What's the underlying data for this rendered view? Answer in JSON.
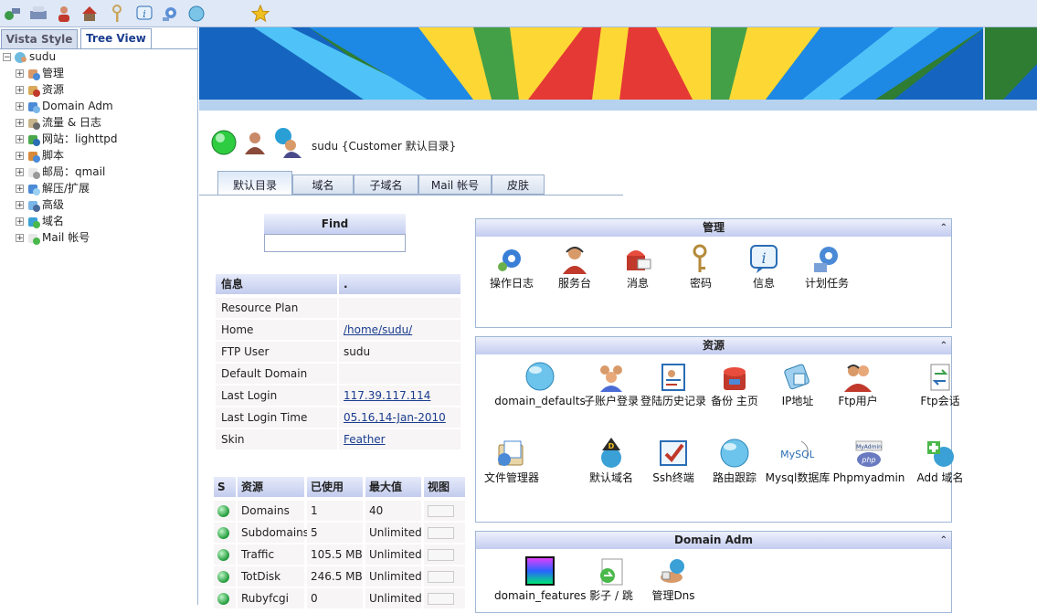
{
  "left_tabs": {
    "vista": "Vista Style",
    "tree": "Tree View"
  },
  "tree": {
    "root": "sudu",
    "items": [
      "管理",
      "资源",
      "Domain Adm",
      "流量 & 日志",
      "网站：lighttpd",
      "脚本",
      "邮局：qmail",
      "解压/扩展",
      "高级",
      "域名",
      "Mail 帐号"
    ]
  },
  "header": {
    "title": "sudu {Customer 默认目录}"
  },
  "tabs": [
    "默认目录",
    "域名",
    "子域名",
    "Mail 帐号",
    "皮肤"
  ],
  "find": {
    "label": "Find",
    "value": ""
  },
  "info": {
    "head_key": "信息",
    "head_val": ".",
    "rows": [
      {
        "k": "Resource Plan",
        "v": ""
      },
      {
        "k": "Home",
        "v": "/home/sudu/"
      },
      {
        "k": "FTP User",
        "v": "sudu"
      },
      {
        "k": "Default Domain",
        "v": ""
      },
      {
        "k": "Last Login",
        "v": "117.39.117.114"
      },
      {
        "k": "Last Login Time",
        "v": "05.16,14-Jan-2010"
      },
      {
        "k": "Skin",
        "v": "Feather"
      }
    ]
  },
  "usage": {
    "headers": [
      "S",
      "资源",
      "已使用",
      "最大值",
      "视图"
    ],
    "rows": [
      {
        "name": "Domains",
        "used": "1",
        "max": "40"
      },
      {
        "name": "Subdomains",
        "used": "5",
        "max": "Unlimited"
      },
      {
        "name": "Traffic",
        "used": "105.5 MB",
        "max": "Unlimited"
      },
      {
        "name": "TotDisk",
        "used": "246.5 MB",
        "max": "Unlimited"
      },
      {
        "name": "Rubyfcgi",
        "used": "0",
        "max": "Unlimited"
      }
    ]
  },
  "panels": {
    "manage": {
      "title": "管理",
      "items": [
        "操作日志",
        "服务台",
        "消息",
        "密码",
        "信息",
        "计划任务"
      ]
    },
    "resources": {
      "title": "资源",
      "items": [
        "domain_defaults",
        "子账户登录",
        "登陆历史记录",
        "备份 主页",
        "IP地址",
        "Ftp用户",
        "Ftp会话",
        "文件管理器",
        "默认域名",
        "Ssh终端",
        "路由跟踪",
        "Mysql数据库",
        "Phpmyadmin",
        "Add 域名"
      ]
    },
    "domainadm": {
      "title": "Domain Adm",
      "items": [
        "domain_features",
        "影子 / 跳",
        "管理Dns"
      ]
    }
  },
  "collapse_glyph": "⌃"
}
